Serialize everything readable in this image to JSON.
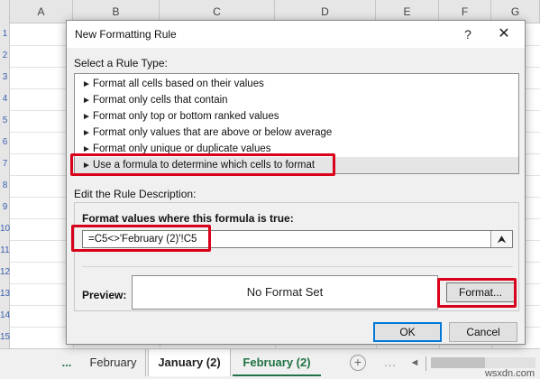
{
  "sheet": {
    "columns": [
      "A",
      "B",
      "C",
      "D",
      "E",
      "F",
      "G"
    ],
    "row_numbers": [
      "1",
      "2",
      "3",
      "4",
      "5",
      "6",
      "7",
      "8",
      "9",
      "10",
      "11",
      "12",
      "13",
      "14",
      "15"
    ]
  },
  "tabs": {
    "more": "...",
    "items": [
      {
        "label": "February"
      },
      {
        "label": "January (2)"
      },
      {
        "label": "February (2)"
      }
    ],
    "add": "+",
    "overflow": "...",
    "scroll_left": "◄"
  },
  "watermark": "wsxdn.com",
  "dialog": {
    "title": "New Formatting Rule",
    "help": "?",
    "close": "✕",
    "rule_type_label": "Select a Rule Type:",
    "rule_types": [
      "Format all cells based on their values",
      "Format only cells that contain",
      "Format only top or bottom ranked values",
      "Format only values that are above or below average",
      "Format only unique or duplicate values",
      "Use a formula to determine which cells to format"
    ],
    "arrow_glyph": "►",
    "edit_label": "Edit the Rule Description:",
    "formula_label": "Format values where this formula is true:",
    "formula_value": "=C5<>'February (2)'!C5",
    "collapse_glyph": "⮝",
    "preview_label": "Preview:",
    "preview_text": "No Format Set",
    "format_button": "Format...",
    "ok_button": "OK",
    "cancel_button": "Cancel"
  },
  "colors": {
    "highlight": "#d9001b",
    "excel_green": "#217346",
    "row_number_blue": "#3a5fb0"
  }
}
